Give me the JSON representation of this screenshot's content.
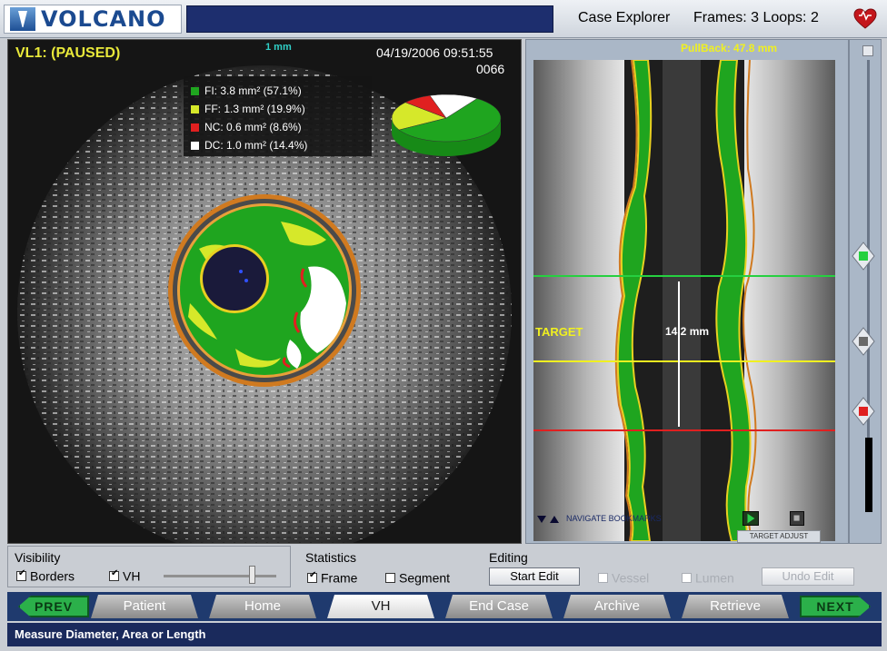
{
  "header": {
    "logo_text": "VOLCANO",
    "case_explorer": "Case Explorer",
    "frames_loops": "Frames: 3 Loops: 2",
    "heart_icon": "heart-icon",
    "brand_color": "#1b4a90"
  },
  "ivus": {
    "status": "VL1: (PAUSED)",
    "scale": "1 mm",
    "timestamp": "04/19/2006 09:51:55",
    "frame_number": "0066",
    "legend": [
      {
        "color": "#1fa51f",
        "text": "FI: 3.8 mm² (57.1%)"
      },
      {
        "color": "#d6e82a",
        "text": "FF: 1.3 mm² (19.9%)"
      },
      {
        "color": "#e02020",
        "text": "NC: 0.6 mm² (8.6%)"
      },
      {
        "color": "#ffffff",
        "text": "DC: 1.0 mm² (14.4%)"
      }
    ],
    "composition_percent": [
      57.1,
      19.9,
      8.6,
      14.4
    ]
  },
  "longitudinal": {
    "pullback": "PullBack: 47.8 mm",
    "target_label": "TARGET",
    "measurement": "14.2 mm",
    "navigate_bookmarks": "NAVIGATE BOOKMARKS",
    "target_adjust": "TARGET ADJUST"
  },
  "controls": {
    "visibility_title": "Visibility",
    "borders_label": "Borders",
    "borders_checked": true,
    "vh_label": "VH",
    "vh_checked": true,
    "statistics_title": "Statistics",
    "frame_label": "Frame",
    "frame_checked": true,
    "segment_label": "Segment",
    "segment_checked": false,
    "editing_title": "Editing",
    "start_edit": "Start Edit",
    "vessel_label": "Vessel",
    "lumen_label": "Lumen",
    "undo_edit": "Undo Edit"
  },
  "tabs": {
    "prev": "PREV",
    "next": "NEXT",
    "items": [
      "Patient",
      "Home",
      "VH",
      "End Case",
      "Archive",
      "Retrieve"
    ],
    "active": "VH"
  },
  "status_text": "Measure Diameter, Area or Length"
}
